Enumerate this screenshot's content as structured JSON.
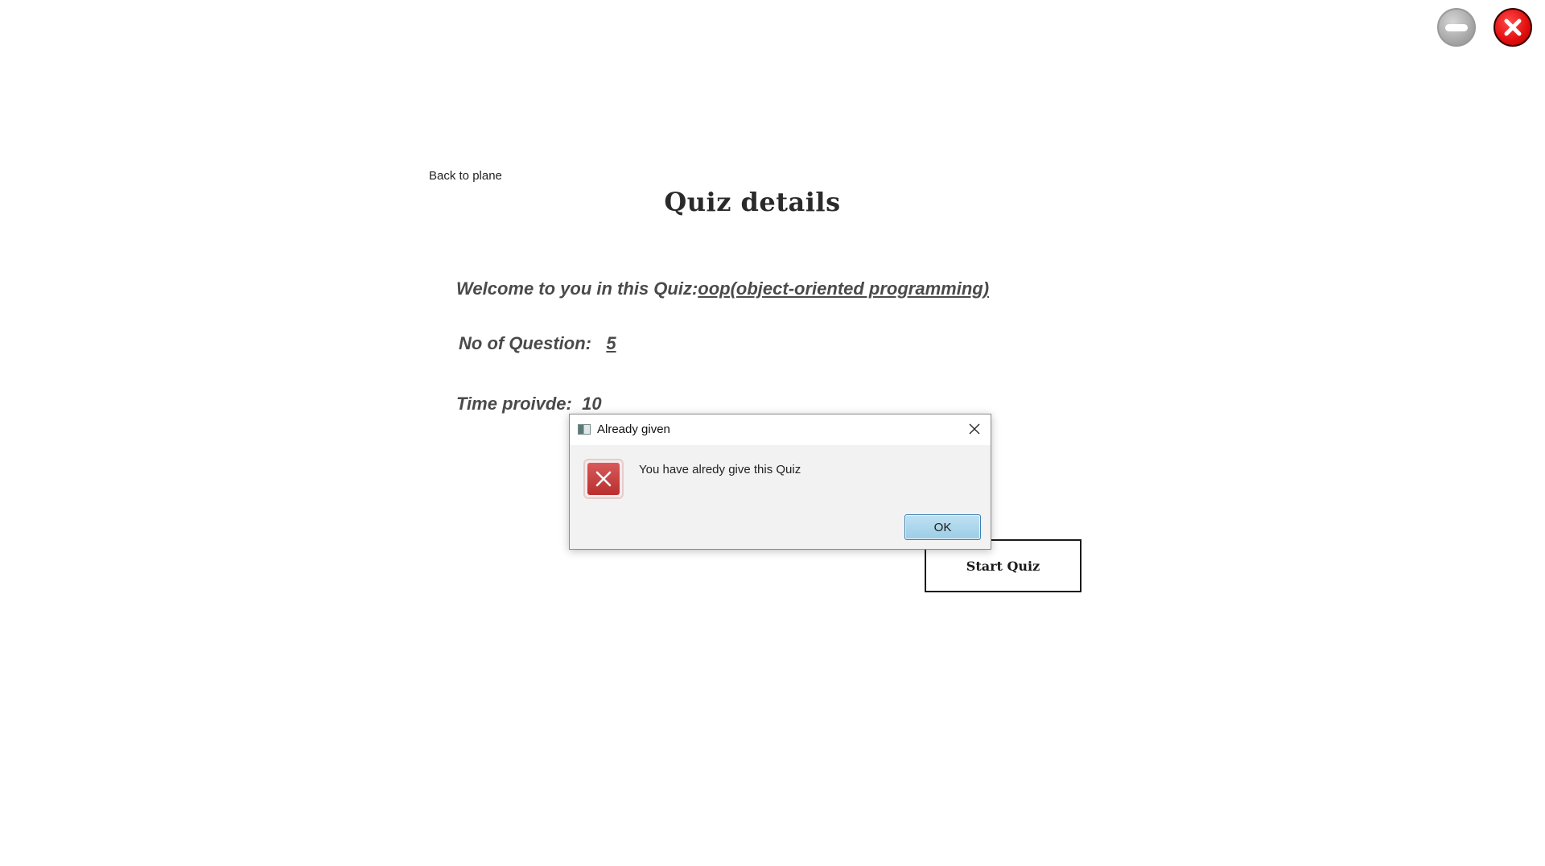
{
  "window_controls": {
    "minimize_icon": "minimize-circle-icon",
    "close_icon": "close-circle-icon"
  },
  "nav": {
    "back_label": "Back to plane"
  },
  "page": {
    "title": "Quiz details"
  },
  "quiz": {
    "welcome_label": "Welcome to you in this Quiz:",
    "quiz_name": "oop(object-oriented programming)",
    "questions_label": "No of Question:",
    "questions_value": "5",
    "time_label": "Time proivde:",
    "time_value": "10"
  },
  "actions": {
    "start_label": "Start Quiz"
  },
  "dialog": {
    "title": "Already given",
    "message": "You have alredy give this Quiz",
    "ok_label": "OK",
    "icon": "error-icon"
  },
  "colors": {
    "close_red": "#e20d0d",
    "minimize_gray": "#a9a9a9",
    "error_red": "#c43a3a",
    "ok_button_blue": "#9ccde6"
  }
}
